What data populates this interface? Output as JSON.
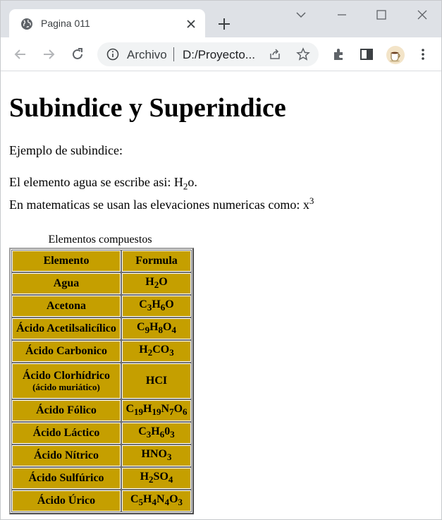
{
  "browser": {
    "tab_title": "Pagina 011",
    "omnibox_scheme_label": "Archivo",
    "omnibox_url": "D:/Proyecto...",
    "accent": "#dee1e6"
  },
  "page": {
    "heading": "Subindice y Superindice",
    "example_label": "Ejemplo de subindice:",
    "water_sentence_prefix": "El elemento agua se escribe asi: H",
    "water_sub": "2",
    "water_sentence_suffix": "o.",
    "math_sentence_prefix": "En matematicas se usan las elevaciones numericas como: x",
    "math_sup": "3",
    "table_caption": "Elementos compuestos",
    "table_header": {
      "element": "Elemento",
      "formula": "Formula"
    },
    "cell_color": "#c59f00",
    "rows": [
      {
        "element": "Agua",
        "formula": [
          [
            "H",
            ""
          ],
          [
            "",
            "2"
          ],
          [
            "O",
            ""
          ]
        ]
      },
      {
        "element": "Acetona",
        "formula": [
          [
            "C",
            ""
          ],
          [
            "",
            "3"
          ],
          [
            "H",
            ""
          ],
          [
            "",
            "6"
          ],
          [
            "O",
            ""
          ]
        ]
      },
      {
        "element": "Ácido Acetilsalicílico",
        "formula": [
          [
            "C",
            ""
          ],
          [
            "",
            "9"
          ],
          [
            "H",
            ""
          ],
          [
            "",
            "8"
          ],
          [
            "O",
            ""
          ],
          [
            "",
            "4"
          ]
        ]
      },
      {
        "element": "Ácido Carbonico",
        "formula": [
          [
            "H",
            ""
          ],
          [
            "",
            "2"
          ],
          [
            "CO",
            ""
          ],
          [
            "",
            "3"
          ]
        ]
      },
      {
        "element": "Ácido Clorhídrico",
        "element_note": "(ácido muriático)",
        "formula": [
          [
            "HCI",
            ""
          ]
        ]
      },
      {
        "element": "Ácido Fólico",
        "formula": [
          [
            "C",
            ""
          ],
          [
            "",
            "19"
          ],
          [
            "H",
            ""
          ],
          [
            "",
            "19"
          ],
          [
            "N",
            ""
          ],
          [
            "",
            "7"
          ],
          [
            "O",
            ""
          ],
          [
            "",
            "6"
          ]
        ]
      },
      {
        "element": "Ácido Láctico",
        "formula": [
          [
            "C",
            ""
          ],
          [
            "",
            "3"
          ],
          [
            "H",
            ""
          ],
          [
            "",
            "6"
          ],
          [
            "0",
            ""
          ],
          [
            "",
            "3"
          ]
        ]
      },
      {
        "element": "Ácido Nítrico",
        "formula": [
          [
            "HNO",
            ""
          ],
          [
            "",
            "3"
          ]
        ]
      },
      {
        "element": "Ácido Sulfúrico",
        "formula": [
          [
            "H",
            ""
          ],
          [
            "",
            "2"
          ],
          [
            "SO",
            ""
          ],
          [
            "",
            "4"
          ]
        ]
      },
      {
        "element": "Ácido Úrico",
        "formula": [
          [
            "C",
            ""
          ],
          [
            "",
            "5"
          ],
          [
            "H",
            ""
          ],
          [
            "",
            "4"
          ],
          [
            "N",
            ""
          ],
          [
            "",
            "4"
          ],
          [
            "O",
            ""
          ],
          [
            "",
            "3"
          ]
        ]
      }
    ]
  }
}
